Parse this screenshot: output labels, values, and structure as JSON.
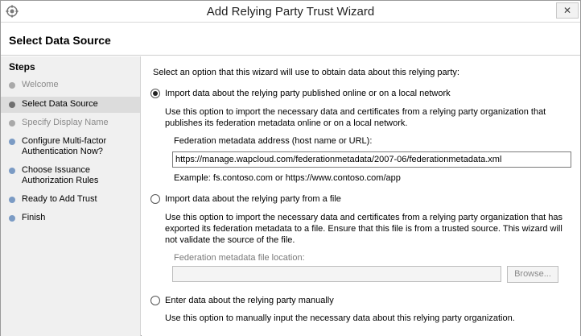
{
  "window": {
    "title": "Add Relying Party Trust Wizard",
    "close_glyph": "✕"
  },
  "header": {
    "title": "Select Data Source"
  },
  "steps": {
    "heading": "Steps",
    "items": [
      {
        "label": "Welcome",
        "state": "done"
      },
      {
        "label": "Select Data Source",
        "state": "current"
      },
      {
        "label": "Specify Display Name",
        "state": "upcoming-disabled"
      },
      {
        "label": "Configure Multi-factor Authentication Now?",
        "state": "upcoming"
      },
      {
        "label": "Choose Issuance Authorization Rules",
        "state": "upcoming"
      },
      {
        "label": "Ready to Add Trust",
        "state": "upcoming"
      },
      {
        "label": "Finish",
        "state": "upcoming"
      }
    ]
  },
  "content": {
    "instruction": "Select an option that this wizard will use to obtain data about this relying party:",
    "option_online": {
      "label": "Import data about the relying party published online or on a local network",
      "selected": true,
      "description": "Use this option to import the necessary data and certificates from a relying party organization that publishes its federation metadata online or on a local network.",
      "field_label": "Federation metadata address (host name or URL):",
      "field_value": "https://manage.wapcloud.com/federationmetadata/2007-06/federationmetadata.xml",
      "example": "Example: fs.contoso.com or https://www.contoso.com/app"
    },
    "option_file": {
      "label": "Import data about the relying party from a file",
      "selected": false,
      "description": "Use this option to import the necessary data and certificates from a relying party organization that has exported its federation metadata to a file. Ensure that this file is from a trusted source.  This wizard will not validate the source of the file.",
      "field_label": "Federation metadata file location:",
      "field_value": "",
      "browse_label": "Browse..."
    },
    "option_manual": {
      "label": "Enter data about the relying party manually",
      "selected": false,
      "description": "Use this option to manually input the necessary data about this relying party organization."
    }
  },
  "colors": {
    "steps_background": "#f0f0f0",
    "current_step_highlight": "#dcdcdc",
    "upcoming_step_dot": "#7b9bc4",
    "disabled_text": "#8a8a8a"
  }
}
